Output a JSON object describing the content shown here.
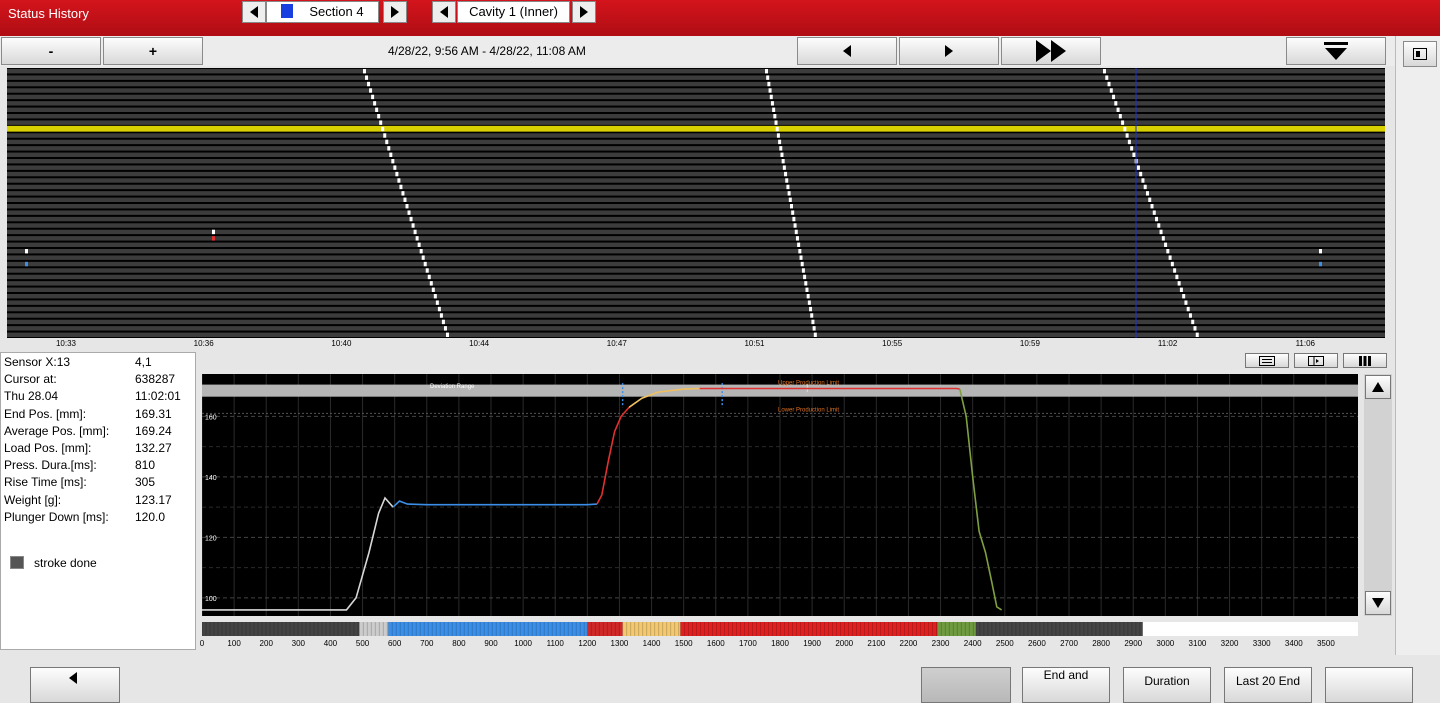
{
  "app_title": "Status History",
  "section_selector": {
    "label": "Section 4",
    "color": "#1a3fe0"
  },
  "cavity_selector": {
    "label": "Cavity 1 (Inner)"
  },
  "toolbar": {
    "zoom_out_label": "-",
    "zoom_in_label": "+",
    "time_range": "4/28/22, 9:56 AM - 4/28/22, 11:08 AM"
  },
  "timeline": {
    "time_labels": [
      "10:33",
      "10:36",
      "10:40",
      "10:44",
      "10:47",
      "10:51",
      "10:55",
      "10:59",
      "11:02",
      "11:06"
    ],
    "highlight_color": "#d8d000",
    "cursor_color": "#1d2fd0"
  },
  "info": {
    "rows": [
      {
        "label": "Sensor X:13",
        "value": "4,1"
      },
      {
        "label": "Cursor at:",
        "value": "638287"
      },
      {
        "label": "Thu 28.04",
        "value": "11:02:01"
      },
      {
        "label": "End Pos. [mm]:",
        "value": "169.31"
      },
      {
        "label": "Average Pos. [mm]:",
        "value": "169.24"
      },
      {
        "label": "Load Pos. [mm]:",
        "value": "132.27"
      },
      {
        "label": "Press. Dura.[ms]:",
        "value": "810"
      },
      {
        "label": "Rise Time [ms]:",
        "value": "305"
      },
      {
        "label": "Weight [g]:",
        "value": "123.17"
      },
      {
        "label": "Plunger Down [ms]:",
        "value": "120.0"
      }
    ],
    "legend_label": "stroke done"
  },
  "chart_data": {
    "type": "line",
    "x_range": [
      0,
      3600
    ],
    "ylim": [
      94,
      174
    ],
    "y_ticks": [
      100,
      120,
      140,
      160
    ],
    "band_labels": {
      "deviation": "Deviation Range",
      "upper_limit": "Upper Production Limit",
      "lower_limit": "Lower Production Limit"
    },
    "segments": [
      {
        "color": "#d8d8d8",
        "points": [
          [
            0,
            96
          ],
          [
            450,
            96
          ],
          [
            480,
            100
          ],
          [
            520,
            115
          ],
          [
            550,
            128
          ],
          [
            570,
            133
          ],
          [
            595,
            130
          ]
        ]
      },
      {
        "color": "#3b8fe8",
        "points": [
          [
            595,
            130
          ],
          [
            615,
            132
          ],
          [
            640,
            131
          ],
          [
            700,
            130.8
          ],
          [
            1200,
            130.8
          ],
          [
            1230,
            131
          ]
        ]
      },
      {
        "color": "#e03030",
        "points": [
          [
            1230,
            131
          ],
          [
            1245,
            134
          ],
          [
            1265,
            145
          ],
          [
            1285,
            155
          ],
          [
            1305,
            160
          ],
          [
            1330,
            163
          ]
        ]
      },
      {
        "color": "#f0c060",
        "points": [
          [
            1330,
            163
          ],
          [
            1370,
            166
          ],
          [
            1420,
            168
          ],
          [
            1500,
            169
          ],
          [
            1550,
            169.2
          ]
        ]
      },
      {
        "color": "#e03030",
        "points": [
          [
            1550,
            169.2
          ],
          [
            2000,
            169.2
          ],
          [
            2350,
            169.2
          ],
          [
            2360,
            169
          ]
        ]
      },
      {
        "color": "#7fa040",
        "points": [
          [
            2360,
            169
          ],
          [
            2380,
            160
          ],
          [
            2400,
            140
          ],
          [
            2420,
            122
          ],
          [
            2440,
            115
          ],
          [
            2460,
            105
          ],
          [
            2475,
            97
          ],
          [
            2490,
            96
          ]
        ]
      }
    ],
    "strip": [
      {
        "start": 0,
        "end": 490,
        "color": "#444444"
      },
      {
        "start": 490,
        "end": 580,
        "color": "#cccccc"
      },
      {
        "start": 580,
        "end": 1200,
        "color": "#3b8fe8"
      },
      {
        "start": 1200,
        "end": 1310,
        "color": "#d02828"
      },
      {
        "start": 1310,
        "end": 1490,
        "color": "#f3c870"
      },
      {
        "start": 1490,
        "end": 2290,
        "color": "#e02020"
      },
      {
        "start": 2290,
        "end": 2410,
        "color": "#6f9a40"
      },
      {
        "start": 2410,
        "end": 2930,
        "color": "#444444"
      },
      {
        "start": 2930,
        "end": 3600,
        "color": "#ffffff"
      }
    ],
    "x_ticks": [
      0,
      100,
      200,
      300,
      400,
      500,
      600,
      700,
      800,
      900,
      1000,
      1100,
      1200,
      1300,
      1400,
      1500,
      1600,
      1700,
      1800,
      1900,
      2000,
      2100,
      2200,
      2300,
      2400,
      2500,
      2600,
      2700,
      2800,
      2900,
      3000,
      3100,
      3200,
      3300,
      3400,
      3500
    ]
  },
  "bottom_buttons": [
    {
      "label": "End and",
      "name": "end-and-button"
    },
    {
      "label": "Duration",
      "name": "duration-button"
    },
    {
      "label": "Last 20 End",
      "name": "last-20-end-button"
    }
  ]
}
